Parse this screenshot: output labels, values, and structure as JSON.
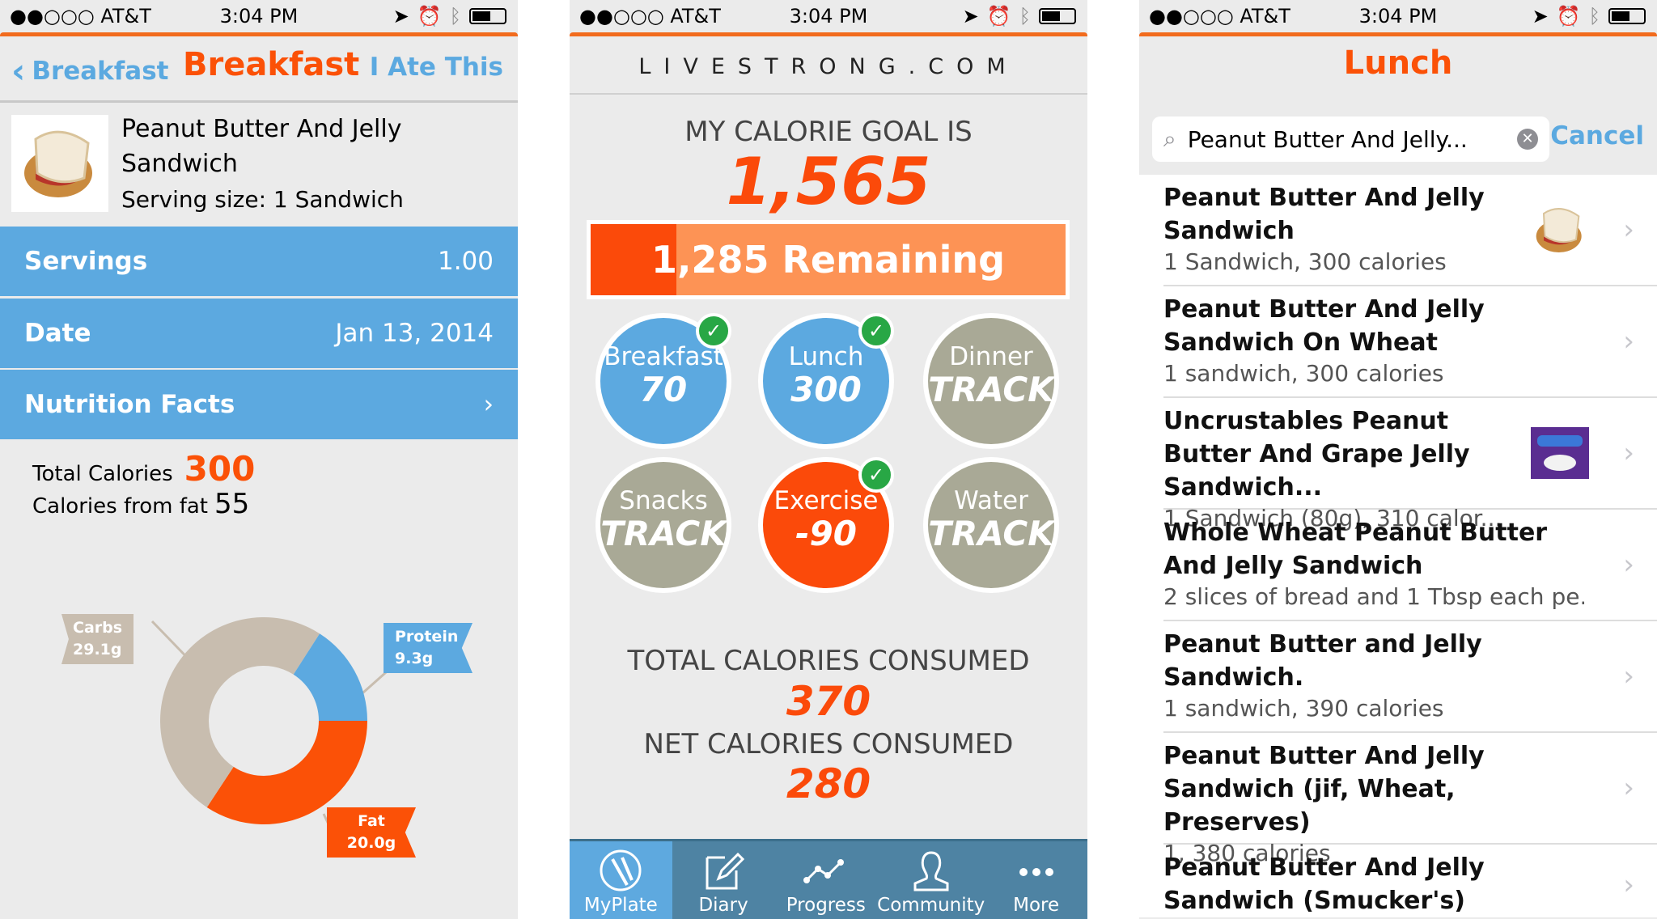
{
  "status": {
    "carrier": "●●○○○ AT&T",
    "time": "3:04 PM"
  },
  "panel1": {
    "back_label": "Breakfast",
    "title": "Breakfast",
    "ate_label": "I Ate This",
    "food_name": "Peanut Butter And Jelly Sandwich",
    "serving": "Serving size: 1 Sandwich",
    "rows": [
      {
        "label": "Servings",
        "value": "1.00"
      },
      {
        "label": "Date",
        "value": "Jan 13, 2014"
      },
      {
        "label": "Nutrition Facts",
        "value": ""
      }
    ],
    "total_calories_label": "Total Calories",
    "total_calories": "300",
    "fat_calories_label": "Calories from fat",
    "fat_calories": "55"
  },
  "chart_data": {
    "type": "pie",
    "donut": true,
    "slices": [
      {
        "name": "Fat",
        "label": "20.0g",
        "value": 20.0,
        "color": "#fb5107"
      },
      {
        "name": "Carbs",
        "label": "29.1g",
        "value": 29.1,
        "color": "#c8bdaf"
      },
      {
        "name": "Protein",
        "label": "9.3g",
        "value": 9.3,
        "color": "#5ca9e0"
      }
    ]
  },
  "panel2": {
    "logo": "LIVESTRONG.COM",
    "goal_label": "MY CALORIE GOAL IS",
    "goal": "1,565",
    "remaining": "1,285 Remaining Today",
    "remaining_fraction": 0.18,
    "meals": [
      {
        "label": "Breakfast",
        "value": "70",
        "color": "#5ca9e0",
        "checked": true
      },
      {
        "label": "Lunch",
        "value": "300",
        "color": "#5ca9e0",
        "checked": true
      },
      {
        "label": "Dinner",
        "value": "TRACK",
        "color": "#a9a996",
        "checked": false
      },
      {
        "label": "Snacks",
        "value": "TRACK",
        "color": "#a9a996",
        "checked": false
      },
      {
        "label": "Exercise",
        "value": "-90",
        "color": "#fb4a0a",
        "checked": true
      },
      {
        "label": "Water",
        "value": "TRACK",
        "color": "#a9a996",
        "checked": false
      }
    ],
    "total_label": "TOTAL CALORIES CONSUMED",
    "total": "370",
    "net_label": "NET CALORIES CONSUMED",
    "net": "280",
    "tabs": [
      {
        "label": "MyPlate",
        "icon": "plate-icon"
      },
      {
        "label": "Diary",
        "icon": "diary-icon"
      },
      {
        "label": "Progress",
        "icon": "progress-icon"
      },
      {
        "label": "Community",
        "icon": "community-icon"
      },
      {
        "label": "More",
        "icon": "more-icon"
      }
    ]
  },
  "panel3": {
    "title": "Lunch",
    "search_value": "Peanut Butter And Jelly...",
    "cancel": "Cancel",
    "results": [
      {
        "title": "Peanut Butter And Jelly Sandwich",
        "sub": "1 Sandwich, 300 calories",
        "thumb": "sandwich"
      },
      {
        "title": "Peanut Butter And Jelly Sandwich On Wheat",
        "sub": "1 sandwich, 300 calories"
      },
      {
        "title": "Uncrustables Peanut Butter And Grape Jelly Sandwich...",
        "sub": "1 Sandwich (80g), 310 calor...",
        "thumb": "box"
      },
      {
        "title": "Whole Wheat Peanut Butter And Jelly Sandwich",
        "sub": "2 slices of bread and 1 Tbsp each pe..."
      },
      {
        "title": "Peanut Butter and Jelly Sandwich.",
        "sub": "1 sandwich, 390 calories"
      },
      {
        "title": "Peanut Butter And Jelly Sandwich (jif, Wheat, Preserves)",
        "sub": "1, 380 calories"
      },
      {
        "title": "Peanut Butter And Jelly Sandwich (Smucker's)",
        "sub": ""
      }
    ]
  }
}
